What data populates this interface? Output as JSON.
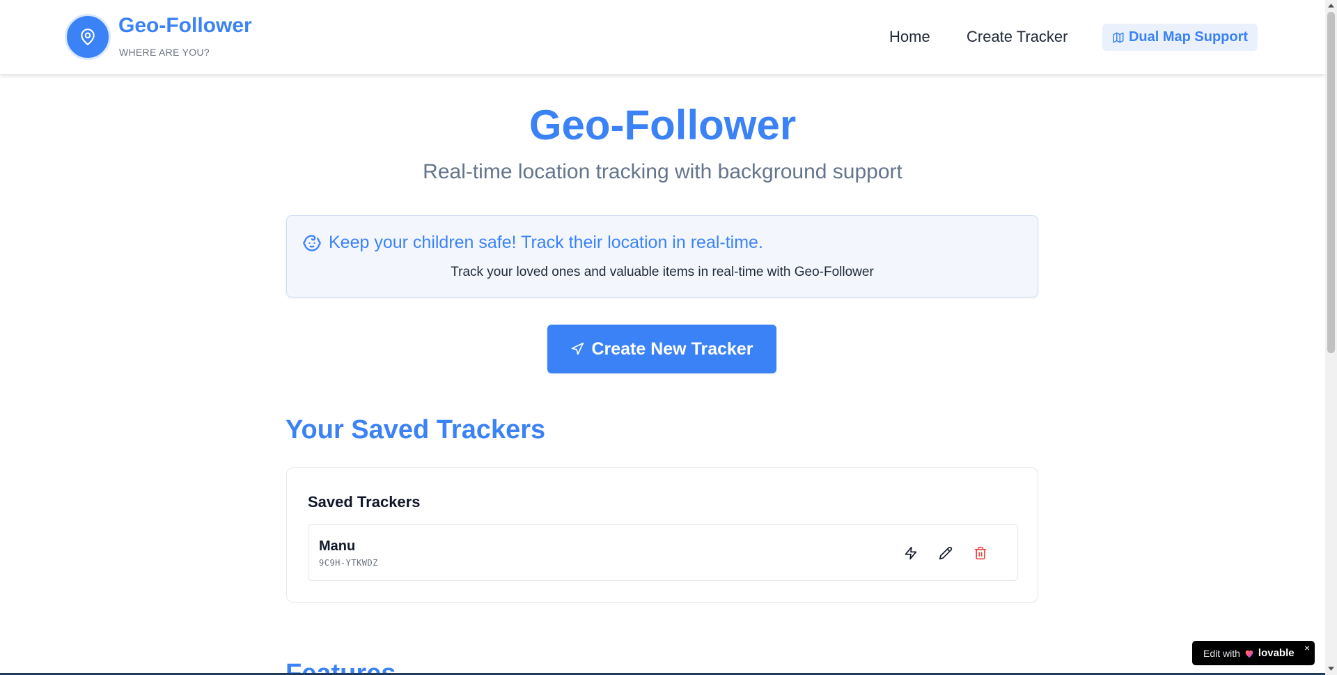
{
  "header": {
    "brand_name": "Geo-Follower",
    "brand_tagline": "WHERE ARE YOU?",
    "nav": {
      "home": "Home",
      "create_tracker": "Create Tracker",
      "dual_map": "Dual Map Support"
    },
    "icons": {
      "logo": "map-pin-icon",
      "dual_map": "map-icon"
    }
  },
  "hero": {
    "title": "Geo-Follower",
    "subtitle": "Real-time location tracking with background support"
  },
  "info_box": {
    "headline": "Keep your children safe! Track their location in real-time.",
    "text": "Track your loved ones and valuable items in real-time with Geo-Follower",
    "icon": "baby-face-icon"
  },
  "cta": {
    "label": "Create New Tracker",
    "icon": "navigation-arrow-icon"
  },
  "saved": {
    "section_title": "Your Saved Trackers",
    "card_title": "Saved Trackers",
    "trackers": [
      {
        "name": "Manu",
        "code": "9C9H-YTKWDZ"
      }
    ],
    "actions": [
      "zap-icon",
      "pencil-icon",
      "trash-icon"
    ]
  },
  "features": {
    "title": "Features"
  },
  "badge": {
    "edit_text": "Edit with",
    "brand": "lovable",
    "close": "×"
  },
  "colors": {
    "primary": "#3b82f6",
    "danger": "#ef4444",
    "subtitle": "#64748b",
    "info_bg": "#f3f7fd"
  }
}
